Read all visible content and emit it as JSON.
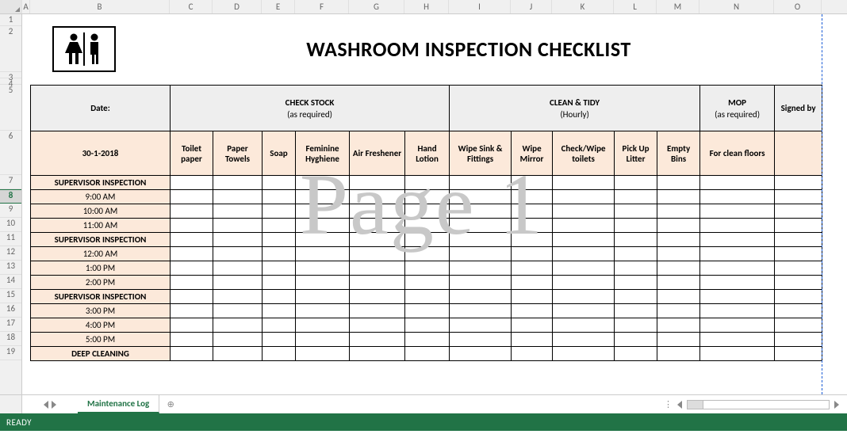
{
  "columns": [
    "A",
    "B",
    "C",
    "D",
    "E",
    "F",
    "G",
    "H",
    "I",
    "J",
    "K",
    "L",
    "M",
    "N",
    "O"
  ],
  "selectedRow": "8",
  "title": "WASHROOM INSPECTION CHECKLIST",
  "dateLabel": "Date:",
  "dateValue": "30-1-2018",
  "groups": {
    "stock": {
      "label": "CHECK STOCK",
      "sub": "(as required)"
    },
    "clean": {
      "label": "CLEAN & TIDY",
      "sub": "(Hourly)"
    },
    "mop": {
      "label": "MOP",
      "sub": "(as required)"
    },
    "signed": {
      "label": "Signed by"
    }
  },
  "subheaders": {
    "c": "Toilet paper",
    "d": "Paper Towels",
    "e": "Soap",
    "f": "Feminine Hyghiene",
    "g": "Air Freshener",
    "h": "Hand Lotion",
    "i": "Wipe Sink & Fittings",
    "j": "Wipe Mirror",
    "k": "Check/Wipe toilets",
    "l": "Pick Up Litter",
    "m": "Empty Bins",
    "n": "For clean floors"
  },
  "rows": [
    {
      "n": "7",
      "label": "SUPERVISOR INSPECTION",
      "type": "sup"
    },
    {
      "n": "8",
      "label": "9:00 AM",
      "type": "time"
    },
    {
      "n": "9",
      "label": "10:00 AM",
      "type": "time"
    },
    {
      "n": "10",
      "label": "11:00 AM",
      "type": "time"
    },
    {
      "n": "11",
      "label": "SUPERVISOR INSPECTION",
      "type": "sup"
    },
    {
      "n": "12",
      "label": "12:00 AM",
      "type": "time"
    },
    {
      "n": "13",
      "label": "1:00 PM",
      "type": "time"
    },
    {
      "n": "14",
      "label": "2:00 PM",
      "type": "time"
    },
    {
      "n": "15",
      "label": "SUPERVISOR INSPECTION",
      "type": "sup"
    },
    {
      "n": "16",
      "label": "3:00 PM",
      "type": "time"
    },
    {
      "n": "17",
      "label": "4:00 PM",
      "type": "time"
    },
    {
      "n": "18",
      "label": "5:00 PM",
      "type": "time"
    },
    {
      "n": "19",
      "label": "DEEP CLEANING",
      "type": "sup"
    }
  ],
  "watermark": "Page 1",
  "tab": "Maintenance Log",
  "status": "READY",
  "icon_name": "restroom-icon",
  "colors": {
    "accent": "#217346",
    "peach": "#fce9da"
  }
}
